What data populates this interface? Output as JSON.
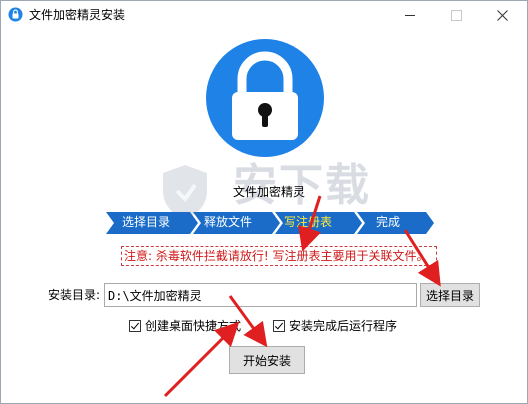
{
  "window": {
    "title": "文件加密精灵安装"
  },
  "product": {
    "name": "文件加密精灵"
  },
  "watermark": {
    "text": "安下载"
  },
  "steps": [
    {
      "label": "选择目录",
      "state": "done"
    },
    {
      "label": "释放文件",
      "state": "done"
    },
    {
      "label": "写注册表",
      "state": "active"
    },
    {
      "label": "完成",
      "state": "todo"
    }
  ],
  "notice": {
    "text": "注意: 杀毒软件拦截请放行! 写注册表主要用于关联文件。"
  },
  "install_dir": {
    "label": "安装目录:",
    "value": "D:\\文件加密精灵",
    "browse_label": "选择目录"
  },
  "options": {
    "desktop_shortcut": {
      "label": "创建桌面快捷方式",
      "checked": true
    },
    "run_after_install": {
      "label": "安装完成后运行程序",
      "checked": true
    }
  },
  "actions": {
    "install_label": "开始安装"
  },
  "colors": {
    "lock_circle": "#1e82e6",
    "step_bar": "#1a6cc8",
    "step_active_text": "#ffeb3b",
    "notice_text": "#d01818",
    "annotation_arrow": "#e02020"
  }
}
